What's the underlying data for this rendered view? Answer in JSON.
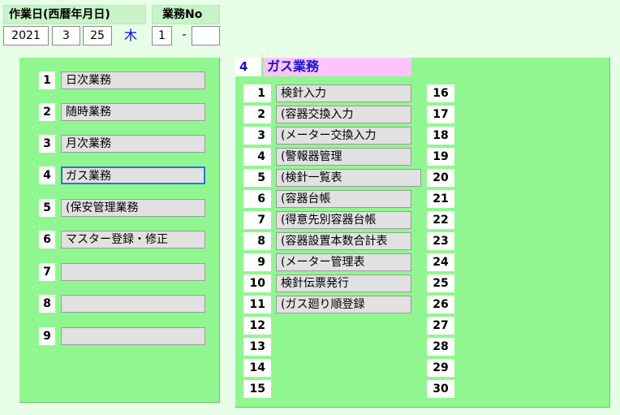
{
  "header": {
    "date_label": "作業日(西暦年月日)",
    "no_label": "業務No",
    "year": "2021",
    "month": "3",
    "day": "25",
    "weekday": "木",
    "no_main": "1",
    "separator": "-",
    "no_sub": ""
  },
  "left_menu": {
    "items": [
      {
        "num": "1",
        "label": "日次業務"
      },
      {
        "num": "2",
        "label": "随時業務"
      },
      {
        "num": "3",
        "label": "月次業務"
      },
      {
        "num": "4",
        "label": "ガス業務"
      },
      {
        "num": "5",
        "label": "(保安管理業務"
      },
      {
        "num": "6",
        "label": "マスター登録・修正"
      },
      {
        "num": "7",
        "label": ""
      },
      {
        "num": "8",
        "label": ""
      },
      {
        "num": "9",
        "label": ""
      }
    ]
  },
  "right_panel": {
    "title_num": "4",
    "title": "ガス業務",
    "items": [
      {
        "num": "1",
        "label": "検針入力"
      },
      {
        "num": "2",
        "label": "(容器交換入力"
      },
      {
        "num": "3",
        "label": "(メーター交換入力"
      },
      {
        "num": "4",
        "label": "(警報器管理"
      },
      {
        "num": "5",
        "label": "(検針一覧表"
      },
      {
        "num": "6",
        "label": "(容器台帳"
      },
      {
        "num": "7",
        "label": "(得意先別容器台帳"
      },
      {
        "num": "8",
        "label": "(容器設置本数合計表"
      },
      {
        "num": "9",
        "label": "(メーター管理表"
      },
      {
        "num": "10",
        "label": "検針伝票発行"
      },
      {
        "num": "11",
        "label": "(ガス廻り順登録"
      },
      {
        "num": "12",
        "label": ""
      },
      {
        "num": "13",
        "label": ""
      },
      {
        "num": "14",
        "label": ""
      },
      {
        "num": "15",
        "label": ""
      }
    ],
    "right_numbers": [
      "16",
      "17",
      "18",
      "19",
      "20",
      "21",
      "22",
      "23",
      "24",
      "25",
      "26",
      "27",
      "28",
      "29",
      "30"
    ]
  }
}
